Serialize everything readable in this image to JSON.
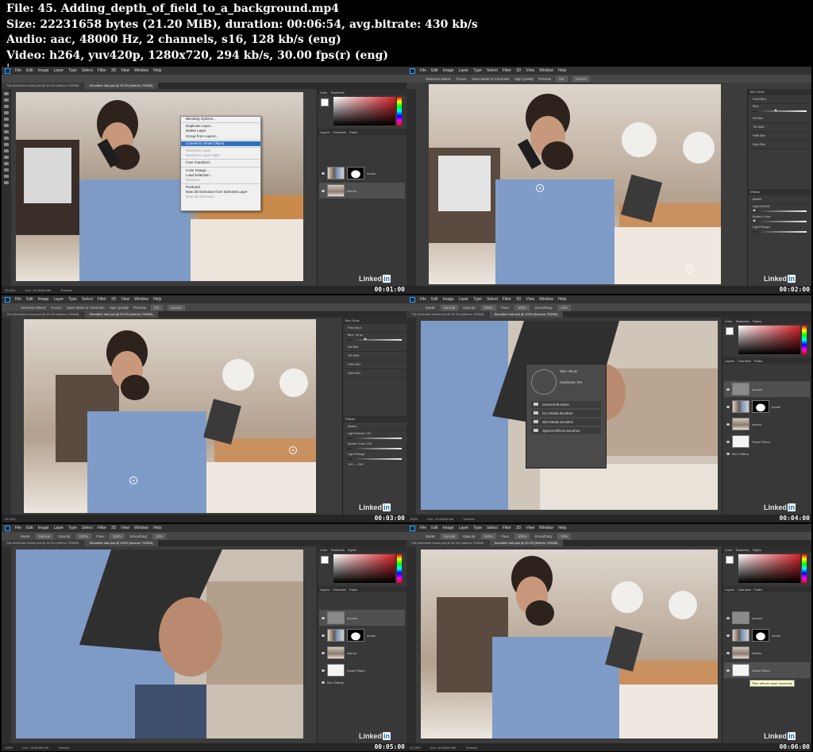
{
  "header": {
    "file_line": "File: 45. Adding_depth_of_field_to_a_background.mp4",
    "size_line": "Size: 22231658 bytes (21.20 MiB), duration: 00:06:54, avg.bitrate: 430 kb/s",
    "audio_line": "Audio: aac, 48000 Hz, 2 channels, s16, 128 kb/s (eng)",
    "video_line": "Video: h264, yuv420p, 1280x720, 294 kb/s, 30.00 fps(r) (eng)",
    "cursor": "|"
  },
  "ps": {
    "menu": [
      "File",
      "Edit",
      "Image",
      "Layer",
      "Type",
      "Select",
      "Filter",
      "3D",
      "View",
      "Window",
      "Help"
    ],
    "tab_a": "The electronic home.psd @ 33.3% (interior, RGB/8)",
    "tab_b": "Smoother hair.psd @ 33.3% (interior, RGB/8)",
    "tab_c": "Smoother hair.psd @ 100% (bounce, RGB/8)",
    "zoom_33": "33.33%",
    "zoom_100": "100%",
    "doc_info": "Doc: 16.0M/59.8M",
    "timeline": "Timeline",
    "watermark_text": "Linked",
    "watermark_box": "in",
    "panel_color": "Color",
    "panel_swatches": "Swatches",
    "panel_styles": "Styles",
    "panel_layers": "Layers",
    "panel_channels": "Channels",
    "panel_paths": "Paths",
    "layer_model": "model",
    "layer_interior": "interior",
    "layer_bounce": "bounce",
    "layer_smart_filters": "Smart Filters",
    "layer_blur_gallery": "Blur Gallery",
    "blur_tools": "Blur Tools",
    "field_blur": "Field Blur",
    "iris_blur": "Iris Blur",
    "tilt_shift": "Tilt-Shift",
    "path_blur": "Path Blur",
    "spin_blur": "Spin Blur",
    "blur_label": "Blur:",
    "blur_value": "15 px",
    "effects": "Effects",
    "bokeh": "Bokeh",
    "light_bokeh": "Light Bokeh:",
    "bokeh_color": "Bokeh Color:",
    "light_range": "Light Range:",
    "pct0": "0%",
    "range_lo": "191",
    "range_hi": "255",
    "blur_options": {
      "selection_bleed": "Selection Bleed:",
      "focus": "Focus:",
      "save_mask": "Save Mask to Channels",
      "high_quality": "High Quality",
      "preview": "Preview",
      "ok": "OK",
      "cancel": "Cancel"
    },
    "brush_options": {
      "mode_label": "Mode:",
      "mode_value": "Normal",
      "opacity_label": "Opacity:",
      "opacity_value": "100%",
      "flow_label": "Flow:",
      "flow_value": "100%",
      "smoothing_label": "Smoothing:",
      "smoothing_value": "10%"
    },
    "context_menu": [
      "Blending Options...",
      "Duplicate Layer...",
      "Delete Layer",
      "Group from Layers...",
      "Convert to Smart Object",
      "Rasterize Layer",
      "Rasterize Layer Style",
      "Free Transform",
      "Color Range...",
      "Load Selection...",
      "Reselect",
      "Postcard",
      "New 3D Extrusion from Selected Layer",
      "New 3D Extrusion"
    ],
    "brush_popup": {
      "size_label": "Size:",
      "size_value": "60 px",
      "hardness_label": "Hardness:",
      "hardness_value": "0%",
      "folders": [
        "General Brushes",
        "Dry Media Brushes",
        "Wet Media Brushes",
        "Special Effects Brushes"
      ]
    },
    "tooltip": "Filter effects mask thumbnail"
  },
  "frames": [
    {
      "timecode": "00:01:00"
    },
    {
      "timecode": "00:02:00"
    },
    {
      "timecode": "00:03:00"
    },
    {
      "timecode": "00:04:00"
    },
    {
      "timecode": "00:05:00"
    },
    {
      "timecode": "00:06:00"
    }
  ],
  "colors": {
    "accent": "#31a8ff",
    "highlight": "#2f6fc4",
    "linkedin_blue": "#0a66c2"
  }
}
